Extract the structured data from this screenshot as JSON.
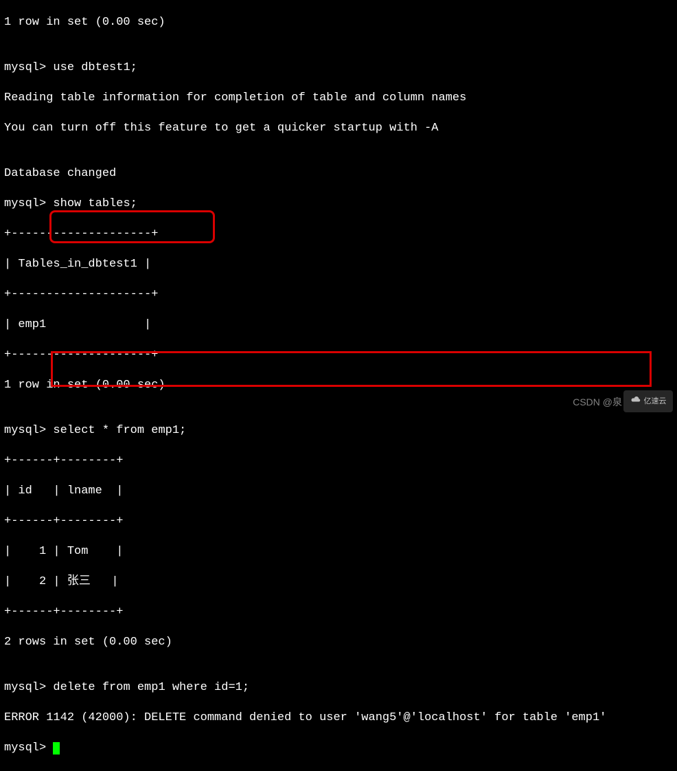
{
  "terminal": {
    "prompt": "mysql> ",
    "lines": {
      "prev_result": "1 row in set (0.00 sec)",
      "blank": "",
      "use_db": "use dbtest1;",
      "reading_info": "Reading table information for completion of table and column names",
      "turn_off": "You can turn off this feature to get a quicker startup with -A",
      "db_changed": "Database changed",
      "show_tables": "show tables;",
      "tbl_border": "+--------------------+",
      "tbl_header": "| Tables_in_dbtest1 |",
      "tbl_emp1": "| emp1              |",
      "one_row": "1 row in set (0.00 sec)",
      "select": "select * from emp1;",
      "res_border": "+------+--------+",
      "res_header": "| id   | lname  |",
      "res_row1": "|    1 | Tom    |",
      "res_row2": "|    2 | 张三   |",
      "two_rows": "2 rows in set (0.00 sec)",
      "delete": "delete from emp1 where id=1;",
      "error": "ERROR 1142 (42000): DELETE command denied to user 'wang5'@'localhost' for table 'emp1'"
    }
  },
  "watermark": {
    "text": "CSDN @泉",
    "logo": "亿速云"
  }
}
